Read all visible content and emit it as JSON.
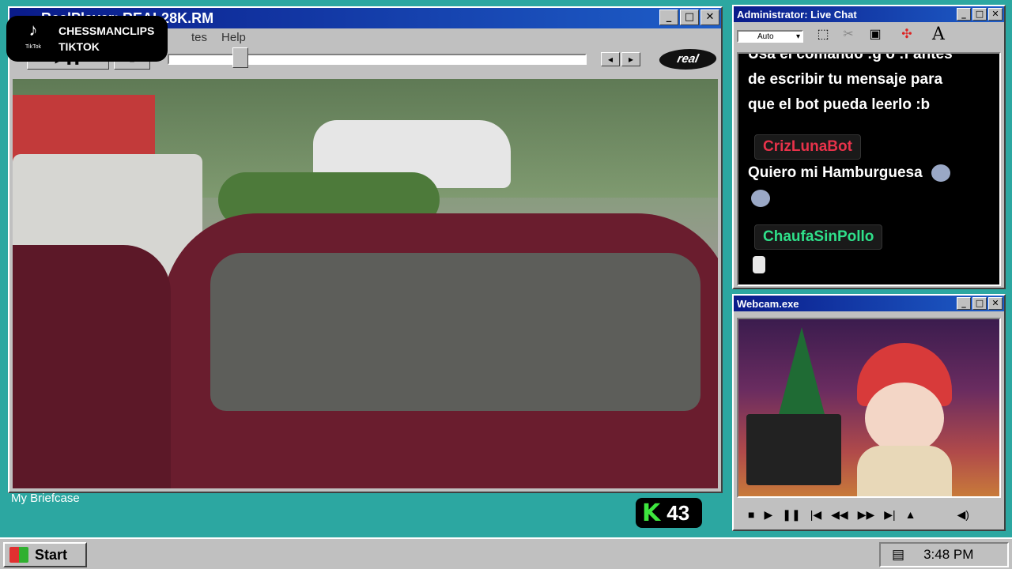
{
  "player": {
    "title": "RealPlayer: REAL28K.RM",
    "menu": [
      "tes",
      "Help"
    ],
    "logo": "real",
    "seek_progress": 0.16,
    "window_buttons": [
      "_",
      "□",
      "✕"
    ]
  },
  "overlay": {
    "tiktok_label": "TikTok",
    "line1": "CHESSMANCLIPS",
    "line2": "TIKTOK"
  },
  "chat": {
    "title": "Administrator: Live Chat",
    "font_select": "Auto",
    "tool_icons": [
      "selection-icon",
      "cut-icon",
      "folder-icon",
      "target-icon",
      "font-icon"
    ],
    "messages": {
      "line1": "Usa el comando :g o :f antes",
      "line2": "de escribir tu mensaje para",
      "line3": "que el bot pueda leerlo :b",
      "user1": "CrizLunaBot",
      "text1": "Quiero mi Hamburguesa",
      "user2": "ChaufaSinPollo"
    },
    "colors": {
      "user1": "#e8324a",
      "user2": "#2fe08a"
    }
  },
  "webcam": {
    "title": "Webcam.exe",
    "controls": [
      "stop-icon",
      "play-icon",
      "pause-icon",
      "prev-icon",
      "rewind-icon",
      "forward-icon",
      "next-icon",
      "eject-icon",
      "volume-icon"
    ]
  },
  "desktop": {
    "briefcase_label": "My Briefcase",
    "score_value": "43",
    "score_icon": "K"
  },
  "taskbar": {
    "start_label": "Start",
    "clock": "3:48 PM"
  }
}
